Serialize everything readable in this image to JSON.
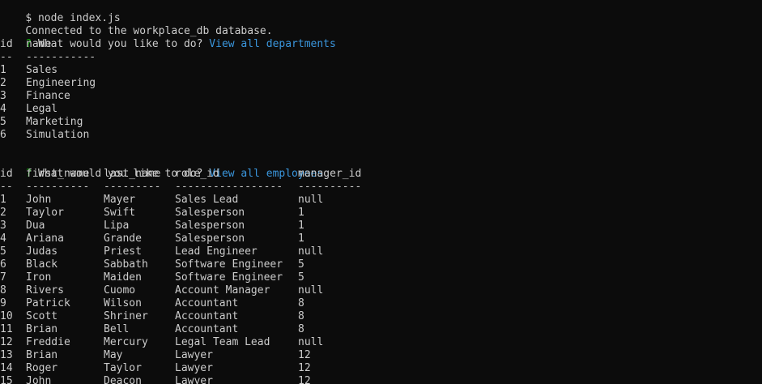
{
  "command": "$ node index.js",
  "connected_msg": "Connected to the workplace_db database.",
  "prompt1": {
    "mark": "?",
    "question": "What would you like to do?",
    "answer": "View all departments"
  },
  "departments": {
    "headers": [
      "id",
      "name"
    ],
    "separators": [
      "--",
      "-----------"
    ],
    "rows": [
      [
        "1",
        "Sales"
      ],
      [
        "2",
        "Engineering"
      ],
      [
        "3",
        "Finance"
      ],
      [
        "4",
        "Legal"
      ],
      [
        "5",
        "Marketing"
      ],
      [
        "6",
        "Simulation"
      ]
    ]
  },
  "prompt2": {
    "mark": "?",
    "question": "What would you like to do?",
    "answer": "View all employees"
  },
  "employees": {
    "headers": [
      "id",
      "first_name",
      "last_name",
      "role_id",
      "manager_id"
    ],
    "separators": [
      "--",
      "----------",
      "---------",
      "-----------------",
      "----------"
    ],
    "rows": [
      [
        "1",
        "John",
        "Mayer",
        "Sales Lead",
        "null"
      ],
      [
        "2",
        "Taylor",
        "Swift",
        "Salesperson",
        "1"
      ],
      [
        "3",
        "Dua",
        "Lipa",
        "Salesperson",
        "1"
      ],
      [
        "4",
        "Ariana",
        "Grande",
        "Salesperson",
        "1"
      ],
      [
        "5",
        "Judas",
        "Priest",
        "Lead Engineer",
        "null"
      ],
      [
        "6",
        "Black",
        "Sabbath",
        "Software Engineer",
        "5"
      ],
      [
        "7",
        "Iron",
        "Maiden",
        "Software Engineer",
        "5"
      ],
      [
        "8",
        "Rivers",
        "Cuomo",
        "Account Manager",
        "null"
      ],
      [
        "9",
        "Patrick",
        "Wilson",
        "Accountant",
        "8"
      ],
      [
        "10",
        "Scott",
        "Shriner",
        "Accountant",
        "8"
      ],
      [
        "11",
        "Brian",
        "Bell",
        "Accountant",
        "8"
      ],
      [
        "12",
        "Freddie",
        "Mercury",
        "Legal Team Lead",
        "null"
      ],
      [
        "13",
        "Brian",
        "May",
        "Lawyer",
        "12"
      ],
      [
        "14",
        "Roger",
        "Taylor",
        "Lawyer",
        "12"
      ],
      [
        "15",
        "John",
        "Deacon",
        "Lawyer",
        "12"
      ]
    ]
  },
  "colors": {
    "background": "#0c0c0c",
    "text": "#cccccc",
    "prompt_mark": "#13a10e",
    "answer": "#3a96dd"
  }
}
